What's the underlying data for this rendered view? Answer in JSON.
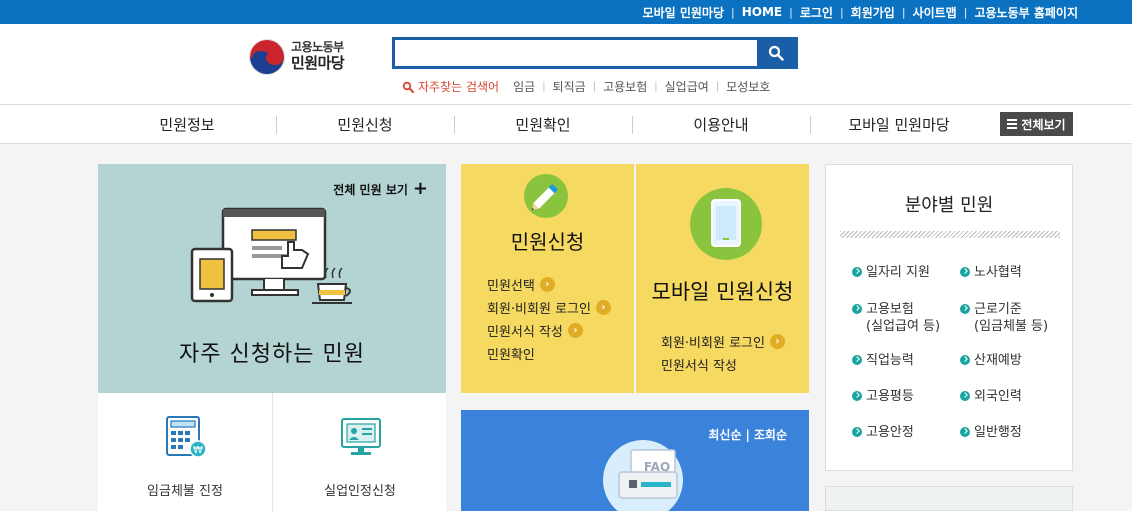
{
  "topbar": {
    "links": [
      "모바일 민원마당",
      "HOME",
      "로그인",
      "회원가입",
      "사이트맵",
      "고용노동부 홈페이지"
    ],
    "separator": "|",
    "bg_color": "#0a72c1"
  },
  "logo": {
    "line1": "고용노동부",
    "line2": "민원마당"
  },
  "search": {
    "value": "",
    "button_icon": "search-icon"
  },
  "keywords": {
    "title": "자주찾는 검색어",
    "items": [
      "임금",
      "퇴직금",
      "고용보험",
      "실업급여",
      "모성보호"
    ]
  },
  "nav": {
    "items": [
      "민원정보",
      "민원신청",
      "민원확인",
      "이용안내",
      "모바일 민원마당"
    ],
    "all_view": "전체보기"
  },
  "frequent": {
    "all_link": "전체 민원 보기",
    "title": "자주 신청하는 민원",
    "tiles": [
      {
        "label": "임금체불 진정",
        "icon": "calculator-icon"
      },
      {
        "label": "실업인정신청",
        "icon": "monitor-icon"
      }
    ],
    "bg_color": "#b3d4d2"
  },
  "apply": {
    "title": "민원신청",
    "icon": "pencil-icon",
    "links": [
      "민원선택",
      "회원·비회원 로그인",
      "민원서식 작성",
      "민원확인"
    ]
  },
  "mobile_apply": {
    "title": "모바일 민원신청",
    "icon": "smartphone-icon",
    "links": [
      "회원·비회원 로그인",
      "민원서식 작성"
    ]
  },
  "faq": {
    "sort_latest": "최신순",
    "sort_sep": "|",
    "sort_views": "조회순",
    "icon_label": "FAQ"
  },
  "field": {
    "title": "분야별 민원",
    "items": [
      {
        "label": "일자리 지원",
        "sub": ""
      },
      {
        "label": "노사협력",
        "sub": ""
      },
      {
        "label": "고용보험",
        "sub": "(실업급여 등)"
      },
      {
        "label": "근로기준",
        "sub": "(임금체불 등)"
      },
      {
        "label": "직업능력",
        "sub": ""
      },
      {
        "label": "산재예방",
        "sub": ""
      },
      {
        "label": "고용평등",
        "sub": ""
      },
      {
        "label": "외국인력",
        "sub": ""
      },
      {
        "label": "고용안정",
        "sub": ""
      },
      {
        "label": "일반행정",
        "sub": ""
      }
    ]
  }
}
